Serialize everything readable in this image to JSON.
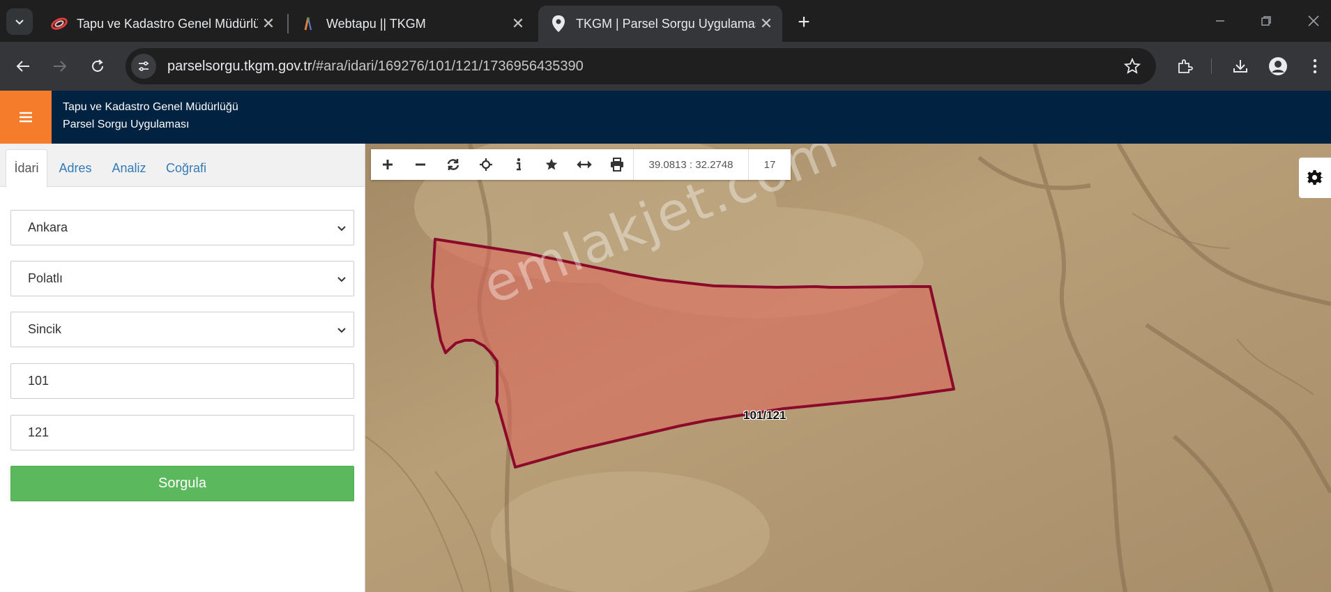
{
  "browser": {
    "tabs": [
      {
        "title": "Tapu ve Kadastro Genel Müdürlüğü",
        "favicon": "tkgm-swirl-icon",
        "active": false
      },
      {
        "title": "Webtapu || TKGM",
        "favicon": "webtapu-icon",
        "active": false
      },
      {
        "title": "TKGM | Parsel Sorgu Uygulaması",
        "favicon": "map-pin-icon",
        "active": true
      }
    ],
    "url_host": "parselsorgu.tkgm.gov.tr",
    "url_path": "/#ara/idari/169276/101/121/1736956435390"
  },
  "header": {
    "org_name": "Tapu ve Kadastro Genel Müdürlüğü",
    "app_name": "Parsel Sorgu Uygulaması",
    "brand_color": "#012341",
    "menu_color": "#f57c2a"
  },
  "sidebar": {
    "tabs": [
      "İdari",
      "Adres",
      "Analiz",
      "Coğrafi"
    ],
    "active_tab": "İdari",
    "province": "Ankara",
    "district": "Polatlı",
    "neighborhood": "Sincik",
    "block_no": "101",
    "parcel_no": "121",
    "query_label": "Sorgula"
  },
  "map": {
    "toolbar_icons": [
      "zoom-in-icon",
      "zoom-out-icon",
      "refresh-icon",
      "locate-icon",
      "info-icon",
      "star-icon",
      "measure-icon",
      "print-icon"
    ],
    "coordinates": "39.0813 : 32.2748",
    "zoom": "17",
    "watermark": "emlakjet.com",
    "parcel_label": "101/121",
    "parcel_stroke": "#8b0a2a",
    "parcel_fill": "#e0645a"
  }
}
